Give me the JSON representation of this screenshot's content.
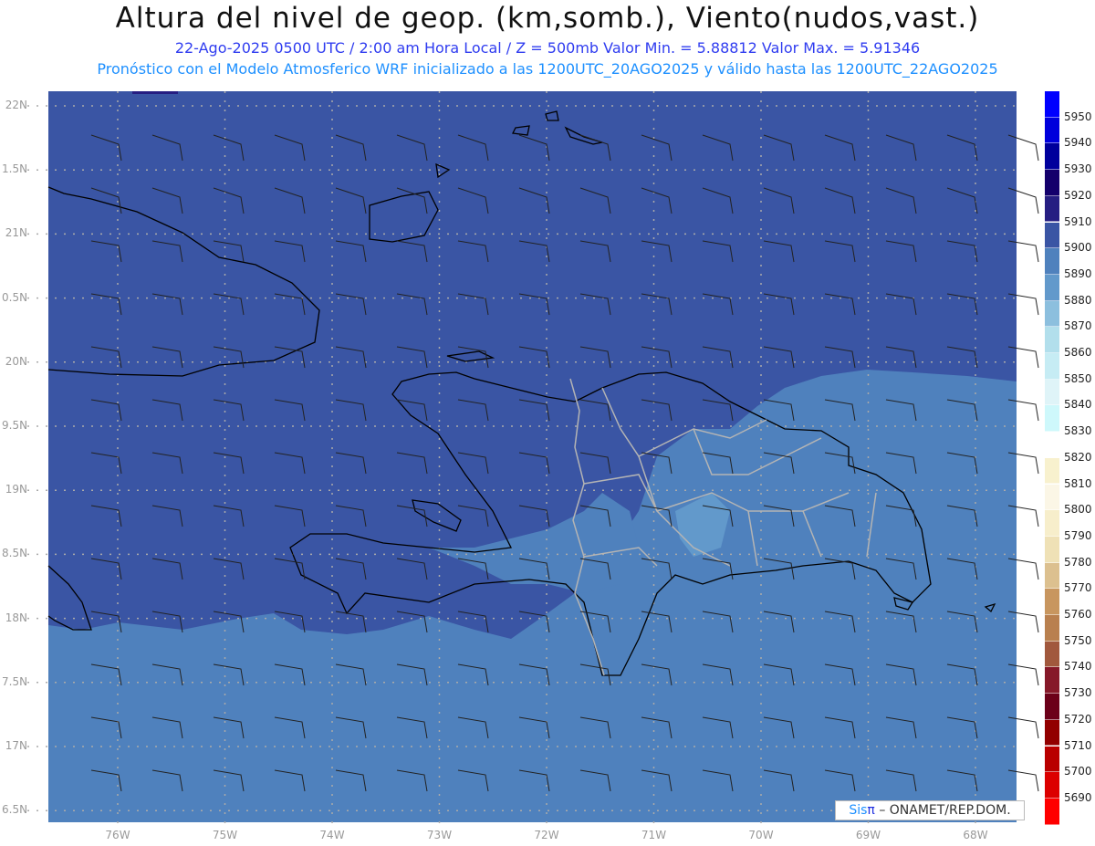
{
  "header": {
    "title": "Altura del nivel de geop. (km,somb.), Viento(nudos,vast.)",
    "subtitle": "22-Ago-2025  0500 UTC / 2:00 am Hora Local / Z = 500mb     Valor Min. = 5.88812  Valor Max. = 5.91346",
    "model_line": "Pronóstico con el Modelo Atmosferico WRF inicializado a las 1200UTC_20AGO2025 y válido hasta las  1200UTC_22AGO2025"
  },
  "axes": {
    "lat_labels": [
      "22N",
      "1.5N",
      "21N",
      "0.5N",
      "20N",
      "9.5N",
      "19N",
      "8.5N",
      "18N",
      "7.5N",
      "17N",
      "6.5N"
    ],
    "lat_values": [
      22,
      21.5,
      21,
      20.5,
      20,
      19.5,
      19,
      18.5,
      18,
      17.5,
      17,
      16.5
    ],
    "lon_labels": [
      "76W",
      "75W",
      "74W",
      "73W",
      "72W",
      "71W",
      "70W",
      "69W",
      "68W"
    ],
    "lon_values": [
      -76,
      -75,
      -74,
      -73,
      -72,
      -71,
      -70,
      -69,
      -68
    ]
  },
  "colorbar": {
    "labels": [
      "5950",
      "5940",
      "5930",
      "5920",
      "5910",
      "5900",
      "5890",
      "5880",
      "5870",
      "5860",
      "5850",
      "5840",
      "5830",
      "5820",
      "5810",
      "5800",
      "5790",
      "5780",
      "5770",
      "5760",
      "5750",
      "5740",
      "5730",
      "5720",
      "5710",
      "5700",
      "5690"
    ],
    "colors": [
      "#0000ff",
      "#0000dc",
      "#00009c",
      "#14006c",
      "#261e82",
      "#3a55a4",
      "#4f81bd",
      "#6299cb",
      "#8cbfde",
      "#b2dfec",
      "#c6ecf4",
      "#dff4f8",
      "#cef8fb",
      "#ffffff",
      "#f8f1ce",
      "#fbf6e6",
      "#f7eecb",
      "#efe1b6",
      "#dcc08f",
      "#c8965f",
      "#b9804f",
      "#a1583d",
      "#861829",
      "#6c0019",
      "#920000",
      "#b90000",
      "#dc0000",
      "#ff0000"
    ]
  },
  "map_colors": {
    "band_5900_5910": "#3a55a4",
    "band_5890_5900": "#4f81bd",
    "band_5880_5890": "#6299cb",
    "coast": "#000000",
    "borders": "#b4b4b4"
  },
  "logo": {
    "sis": "Sis",
    "pi": "π",
    "rest": "– ONAMET/REP.DOM."
  }
}
